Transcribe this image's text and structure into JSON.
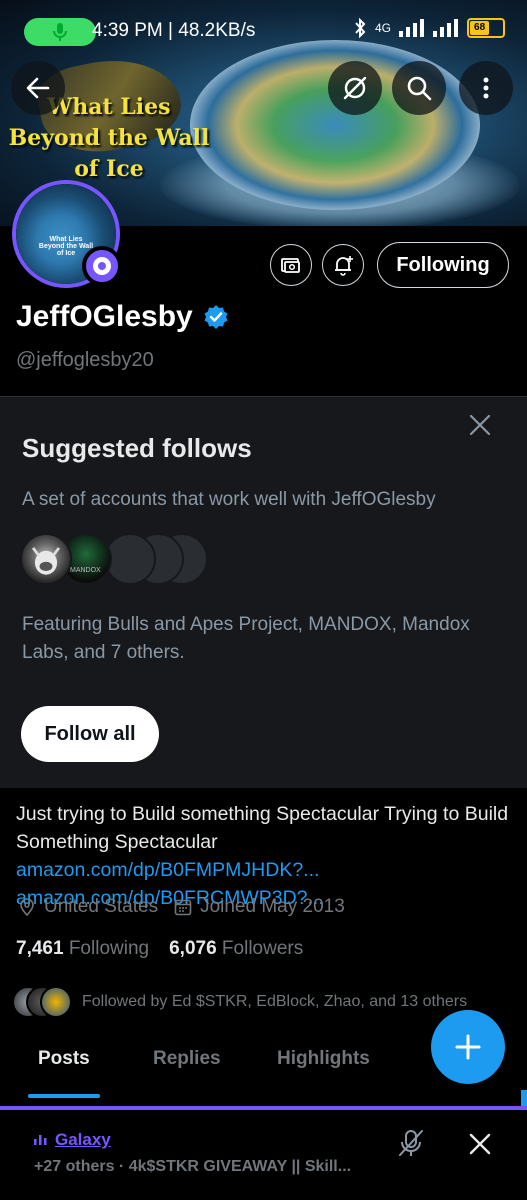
{
  "status_bar": {
    "time_speed": "4:39 PM | 48.2KB/s",
    "network": "4G",
    "battery": "68"
  },
  "banner": {
    "title": "What Lies Beyond the Wall of Ice"
  },
  "profile": {
    "display_name": "JeffOGlesby",
    "handle": "@jeffoglesby20",
    "following_button": "Following",
    "avatar_caption": "What Lies Beyond the Wall of Ice"
  },
  "suggested": {
    "title": "Suggested follows",
    "subtitle": "A set of accounts that work well with JeffOGlesby",
    "featuring": "Featuring Bulls and Apes Project, MANDOX, Mandox Labs, and 7 others.",
    "follow_all": "Follow all",
    "avatar2_label": "MANDOX"
  },
  "bio": {
    "text": "Just trying to Build something Spectacular Trying to Build Something Spectacular ",
    "link1": "amazon.com/dp/B0FMPMJHDK?...",
    "link2": "amazon.com/dp/B0FRCMWP3D?..."
  },
  "meta": {
    "location": "United States",
    "joined": "Joined May 2013"
  },
  "stats": {
    "following_count": "7,461",
    "following_label": "Following",
    "followers_count": "6,076",
    "followers_label": "Followers"
  },
  "followed_by": "Followed by Ed $STKR, EdBlock, Zhao, and 13 others",
  "tabs": [
    "Posts",
    "Replies",
    "Highlights"
  ],
  "space": {
    "name": "Galaxy",
    "description": "+27 others · 4k$STKR GIVEAWAY || Skill..."
  },
  "colors": {
    "accent": "#1d9bf0",
    "spaces_purple": "#7856ff",
    "banner_title": "#f4e33a"
  }
}
